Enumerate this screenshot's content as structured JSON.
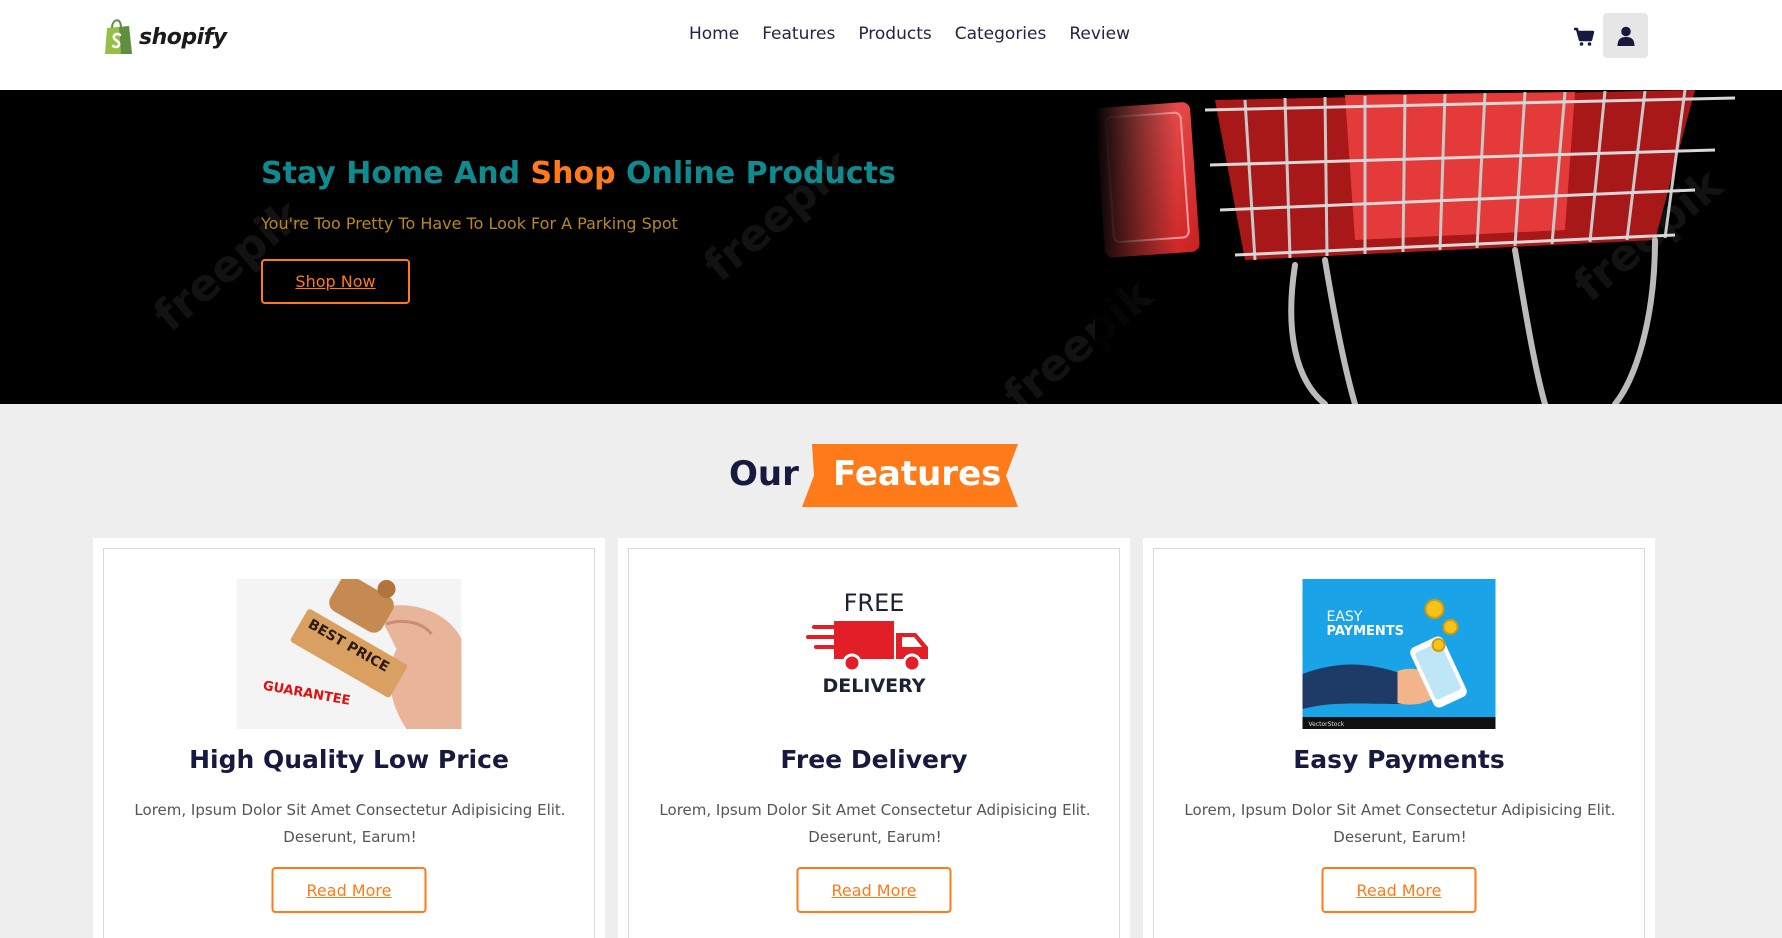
{
  "brand": {
    "name": "shopify",
    "accent": "#ff7a18",
    "teal": "#0f8a8f",
    "dark": "#17193f"
  },
  "nav": {
    "items": [
      "Home",
      "Features",
      "Products",
      "Categories",
      "Review"
    ]
  },
  "header_icons": {
    "cart": "cart-icon",
    "user": "user-icon"
  },
  "hero": {
    "title_part1": "Stay Home And ",
    "title_accent": "Shop",
    "title_part2": " Online Products",
    "subtitle": "You're Too Pretty To Have To Look For A Parking Spot",
    "button": "Shop Now",
    "watermark": "freepik"
  },
  "features": {
    "heading_plain": "Our",
    "heading_accent": "Features",
    "cards": [
      {
        "title": "High Quality Low Price",
        "text": "Lorem, Ipsum Dolor Sit Amet Consectetur Adipisicing Elit. Deserunt, Earum!",
        "button": "Read More",
        "image_text": [
          "BEST PRICE",
          "GUARANTEE"
        ]
      },
      {
        "title": "Free Delivery",
        "text": "Lorem, Ipsum Dolor Sit Amet Consectetur Adipisicing Elit. Deserunt, Earum!",
        "button": "Read More",
        "image_text": [
          "FREE",
          "DELIVERY"
        ]
      },
      {
        "title": "Easy Payments",
        "text": "Lorem, Ipsum Dolor Sit Amet Consectetur Adipisicing Elit. Deserunt, Earum!",
        "button": "Read More",
        "image_text": [
          "EASY",
          "PAYMENTS",
          "VectorStock"
        ]
      }
    ]
  }
}
